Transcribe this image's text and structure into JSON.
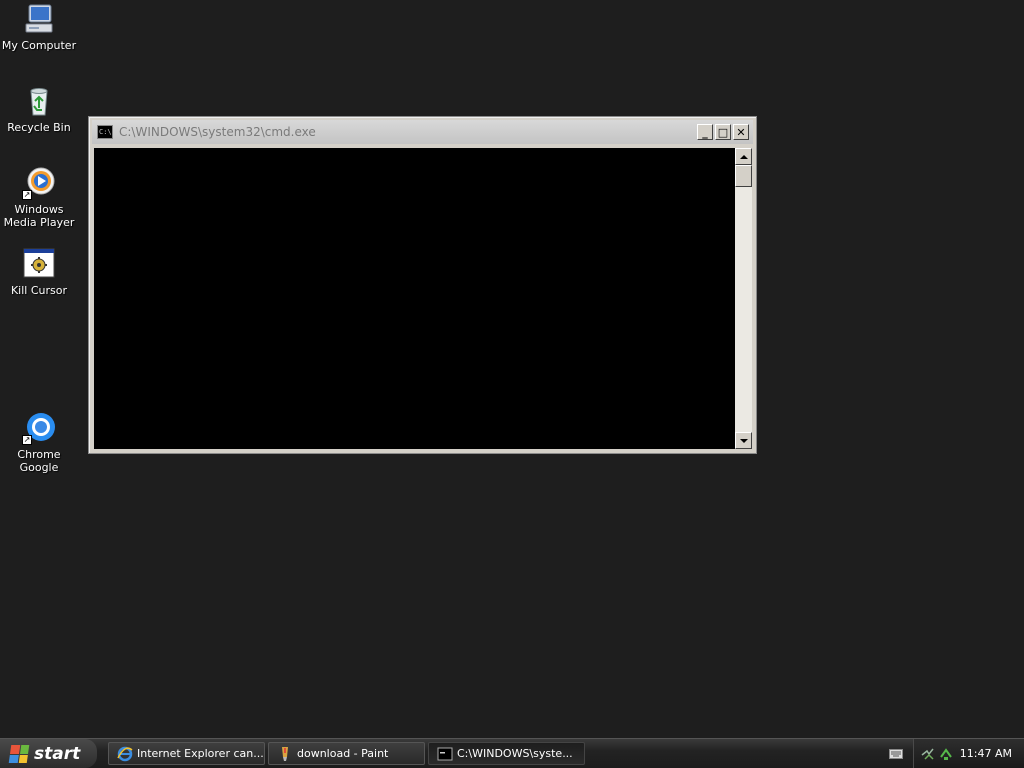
{
  "desktop": {
    "icons": [
      {
        "label": "My Computer",
        "icon": "my-computer-icon"
      },
      {
        "label": "Recycle Bin",
        "icon": "recycle-bin-icon"
      },
      {
        "label": "Windows Media Player",
        "icon": "windows-media-player-icon"
      },
      {
        "label": "Kill Cursor",
        "icon": "kill-cursor-icon"
      },
      {
        "label": "Chrome Google",
        "icon": "chrome-icon"
      }
    ]
  },
  "window": {
    "title": "C:\\WINDOWS\\system32\\cmd.exe",
    "icon_text": "C:\\",
    "minimize_glyph": "_",
    "maximize_glyph": "□",
    "close_glyph": "✕",
    "console_text": ""
  },
  "taskbar": {
    "start_label": "start",
    "tasks": [
      {
        "label": "Internet Explorer can...",
        "icon": "internet-explorer-icon",
        "active": false
      },
      {
        "label": "download - Paint",
        "icon": "paint-icon",
        "active": false
      },
      {
        "label": "C:\\WINDOWS\\syste...",
        "icon": "cmd-icon",
        "active": true
      }
    ],
    "tray": {
      "clock": "11:47 AM"
    }
  },
  "colors": {
    "desktop_background": "#1e1e1e",
    "console_background": "#000000",
    "taskbar": "#232323"
  }
}
